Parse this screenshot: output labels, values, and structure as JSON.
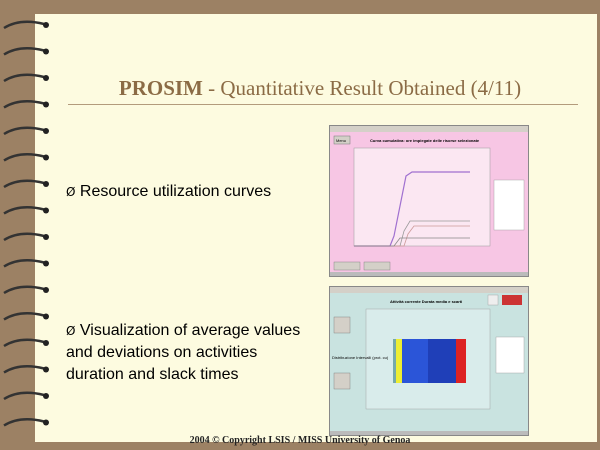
{
  "slide": {
    "title_bold": "PROSIM",
    "title_rest": " - Quantitative Result Obtained (4/11)",
    "bullet1": "Resource utilization curves",
    "bullet2": "Visualization of average values and deviations on activities duration and slack times",
    "bullet_marker": "Ø",
    "footer": "2004 © Copyright LSIS / MISS University of Genoa"
  },
  "screenshot1": {
    "chart_title": "Curva cumulativa: ore impiegate delle risorse selezionate",
    "button": "Menu"
  },
  "screenshot2": {
    "chart_title": "Attività corrente Durata media e scarti",
    "box_label": "Distribuzione Intervalli (prot. cu)"
  },
  "colors": {
    "paper": "#fdfbe0",
    "wood": "#9c8164",
    "title": "#8b6b45"
  }
}
